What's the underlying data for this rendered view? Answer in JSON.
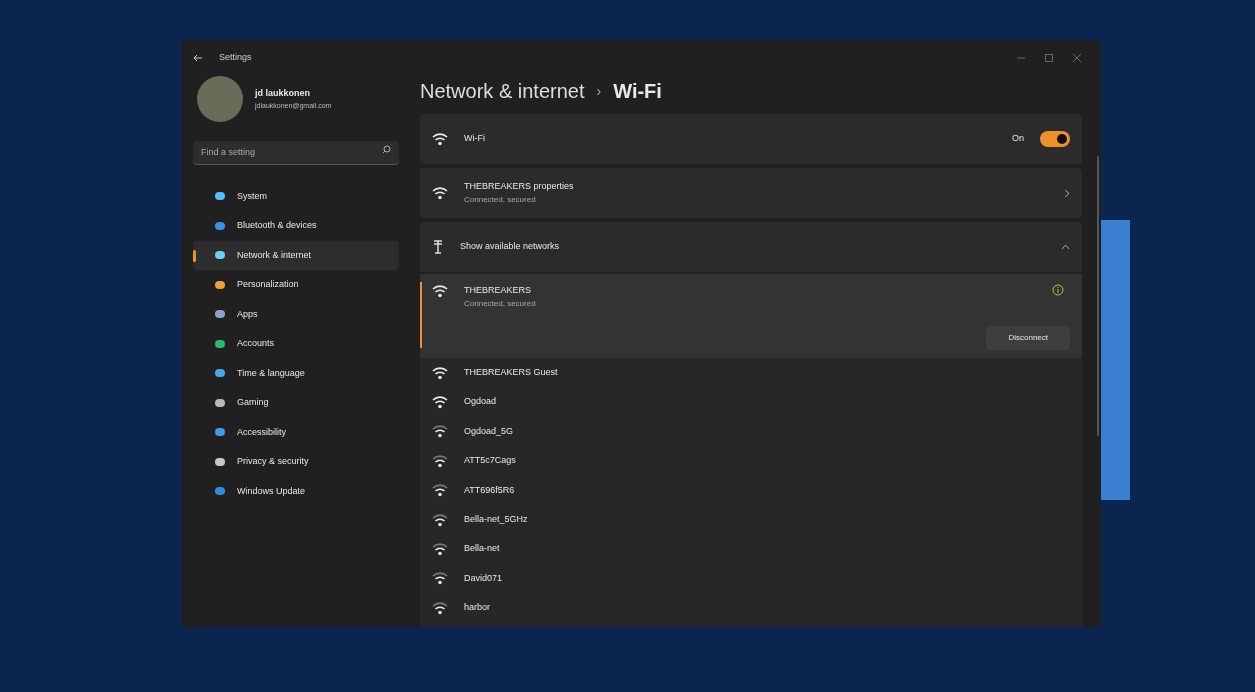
{
  "window": {
    "title": "Settings"
  },
  "user": {
    "name": "jd laukkonen",
    "email": "jdlaukkonen@gmail.com"
  },
  "search": {
    "placeholder": "Find a setting"
  },
  "sidebar": {
    "items": [
      {
        "label": "System",
        "selected": false
      },
      {
        "label": "Bluetooth & devices",
        "selected": false
      },
      {
        "label": "Network & internet",
        "selected": true
      },
      {
        "label": "Personalization",
        "selected": false
      },
      {
        "label": "Apps",
        "selected": false
      },
      {
        "label": "Accounts",
        "selected": false
      },
      {
        "label": "Time & language",
        "selected": false
      },
      {
        "label": "Gaming",
        "selected": false
      },
      {
        "label": "Accessibility",
        "selected": false
      },
      {
        "label": "Privacy & security",
        "selected": false
      },
      {
        "label": "Windows Update",
        "selected": false
      }
    ]
  },
  "breadcrumb": {
    "parent": "Network & internet",
    "separator": "›",
    "current": "Wi-Fi"
  },
  "wifi": {
    "label": "Wi-Fi",
    "state_label": "On",
    "on": true
  },
  "properties": {
    "title": "THEBREAKERS properties",
    "subtitle": "Connected, secured"
  },
  "available": {
    "label": "Show available networks",
    "expanded": true
  },
  "networks": [
    {
      "name": "THEBREAKERS",
      "status": "Connected, secured",
      "action": "Disconnect",
      "selected": true
    },
    {
      "name": "THEBREAKERS Guest",
      "selected": false
    },
    {
      "name": "Ogdoad",
      "selected": false
    },
    {
      "name": "Ogdoad_5G",
      "selected": false
    },
    {
      "name": "ATT5c7Cags",
      "selected": false
    },
    {
      "name": "ATT696f5R6",
      "selected": false
    },
    {
      "name": "Bella-net_5GHz",
      "selected": false
    },
    {
      "name": "Bella-net",
      "selected": false
    },
    {
      "name": "David071",
      "selected": false
    },
    {
      "name": "harbor",
      "selected": false
    }
  ]
}
